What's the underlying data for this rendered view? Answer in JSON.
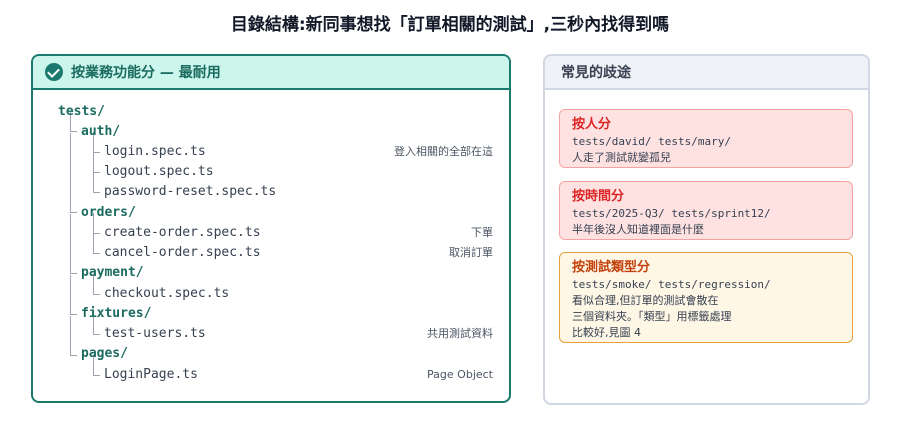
{
  "title": "目錄結構:新同事想找「訂單相關的測試」,三秒內找得到嗎",
  "left": {
    "header": "按業務功能分 — 最耐用",
    "tree": [
      {
        "text": "tests/",
        "kind": "dir",
        "note": ""
      },
      {
        "text": "auth/",
        "kind": "dir",
        "note": ""
      },
      {
        "text": "login.spec.ts",
        "kind": "file",
        "note": "登入相關的全部在這"
      },
      {
        "text": "logout.spec.ts",
        "kind": "file",
        "note": ""
      },
      {
        "text": "password-reset.spec.ts",
        "kind": "file",
        "note": ""
      },
      {
        "text": "orders/",
        "kind": "dir",
        "note": ""
      },
      {
        "text": "create-order.spec.ts",
        "kind": "file",
        "note": "下單"
      },
      {
        "text": "cancel-order.spec.ts",
        "kind": "file",
        "note": "取消訂單"
      },
      {
        "text": "payment/",
        "kind": "dir",
        "note": ""
      },
      {
        "text": "checkout.spec.ts",
        "kind": "file",
        "note": ""
      },
      {
        "text": "fixtures/",
        "kind": "dir",
        "note": ""
      },
      {
        "text": "test-users.ts",
        "kind": "file",
        "note": "共用測試資料"
      },
      {
        "text": "pages/",
        "kind": "dir",
        "note": ""
      },
      {
        "text": "LoginPage.ts",
        "kind": "file",
        "note": "Page Object"
      }
    ]
  },
  "right": {
    "header": "常見的歧途",
    "cards": [
      {
        "style": "red",
        "title": "按人分",
        "code": "tests/david/ tests/mary/",
        "desc": "人走了測試就變孤兒"
      },
      {
        "style": "red",
        "title": "按時間分",
        "code": "tests/2025-Q3/ tests/sprint12/",
        "desc": "半年後沒人知道裡面是什麼"
      },
      {
        "style": "amber",
        "title": "按測試類型分",
        "code": "tests/smoke/ tests/regression/",
        "desc": "看似合理,但訂單的測試會散在\n三個資料夾。「類型」用標籤處理\n比較好,見圖 4"
      }
    ]
  }
}
